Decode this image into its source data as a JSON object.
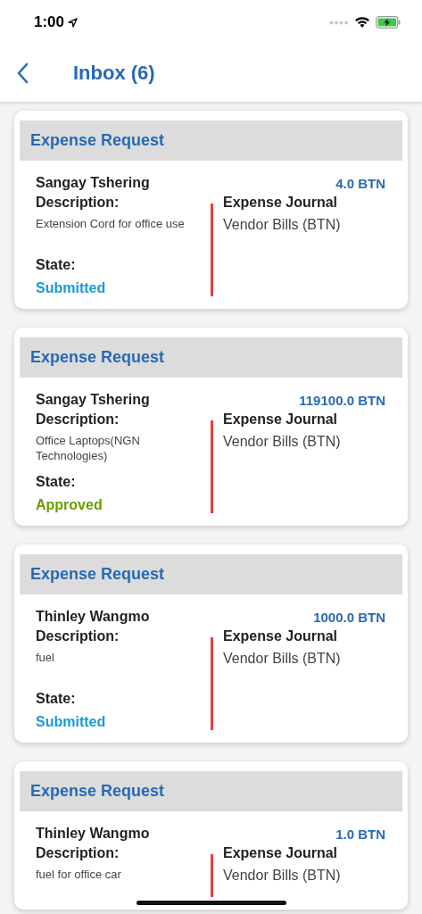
{
  "status_bar": {
    "time": "1:00"
  },
  "nav": {
    "title": "Inbox (6)"
  },
  "cards": [
    {
      "title": "Expense Request",
      "name": "Sangay Tshering",
      "amount": "4.0 BTN",
      "description_label": "Description:",
      "description": "Extension Cord for office use",
      "state_label": "State:",
      "state": "Submitted",
      "color": "#1a9ad6",
      "journal_label": "Expense Journal",
      "journal": "Vendor Bills (BTN)"
    },
    {
      "title": "Expense Request",
      "name": "Sangay Tshering",
      "amount": "119100.0 BTN",
      "description_label": "Description:",
      "description": "Office Laptops(NGN Technologies)",
      "state_label": "State:",
      "state": "Approved",
      "color": "#6a9c00",
      "journal_label": "Expense Journal",
      "journal": "Vendor Bills (BTN)"
    },
    {
      "title": "Expense Request",
      "name": "Thinley Wangmo",
      "amount": "1000.0 BTN",
      "description_label": "Description:",
      "description": "fuel",
      "state_label": "State:",
      "state": "Submitted",
      "color": "#1a9ad6",
      "journal_label": "Expense Journal",
      "journal": "Vendor Bills (BTN)"
    },
    {
      "title": "Expense Request",
      "name": "Thinley Wangmo",
      "amount": "1.0 BTN",
      "description_label": "Description:",
      "description": "fuel for office car",
      "journal_label": "Expense Journal",
      "journal": "Vendor Bills (BTN)"
    }
  ]
}
